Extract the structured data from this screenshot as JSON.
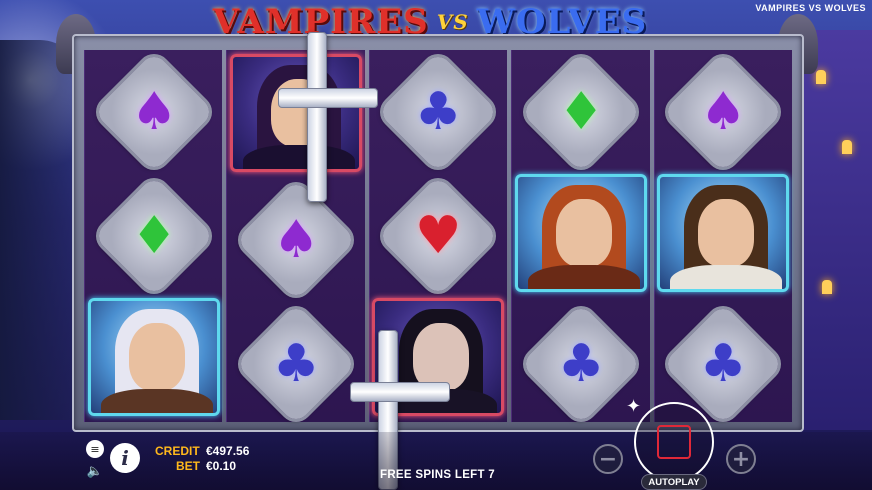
{
  "title": {
    "left_word": "VAMPIRES",
    "vs": "VS",
    "right_word": "WOLVES",
    "corner_name": "VAMPIRES VS WOLVES"
  },
  "reels": [
    [
      "spade-purple",
      "diamond-green",
      "werewolf-white-hair"
    ],
    [
      "vampire-portrait",
      "spade-purple",
      "club-blue"
    ],
    [
      "club-blue",
      "heart-red",
      "vampire-portrait"
    ],
    [
      "diamond-green",
      "werewolf-red-hair-woman",
      "club-blue"
    ],
    [
      "spade-purple",
      "werewolf-brown-hair",
      "club-blue"
    ]
  ],
  "colors": {
    "spade": "#8e2ad0",
    "club": "#3d3ec8",
    "diamond": "#2fc43a",
    "heart": "#d9202e",
    "credit_label": "#ffb81c",
    "stop_square": "#e02838"
  },
  "hud": {
    "credit_label": "CREDIT",
    "credit_value": "€497.56",
    "bet_label": "BET",
    "bet_value": "€0.10",
    "free_spins_text": "FREE SPINS LEFT 7",
    "minus_label": "−",
    "plus_label": "+",
    "autoplay_label": "AUTOPLAY",
    "info_label": "i",
    "menu_label": "≡",
    "sound_label": "🔈"
  }
}
